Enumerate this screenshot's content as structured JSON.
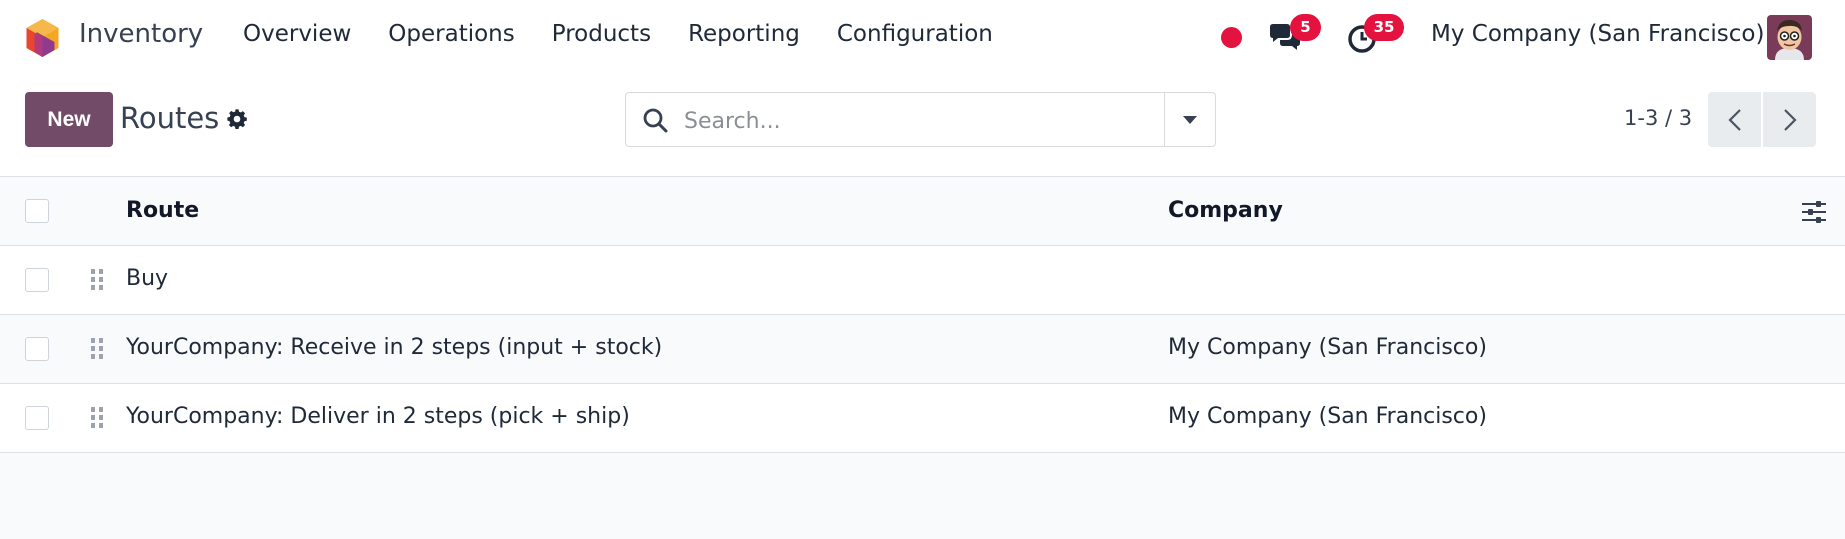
{
  "navbar": {
    "app_name": "Inventory",
    "menu": [
      "Overview",
      "Operations",
      "Products",
      "Reporting",
      "Configuration"
    ],
    "messages_count": "5",
    "activities_count": "35",
    "company": "My Company (San Francisco)",
    "status_color": "#e3123f"
  },
  "control": {
    "new_label": "New",
    "title": "Routes",
    "search_placeholder": "Search...",
    "pager_value": "1-3 / 3"
  },
  "table": {
    "columns": [
      "Route",
      "Company"
    ],
    "rows": [
      {
        "route": "Buy",
        "company": ""
      },
      {
        "route": "YourCompany: Receive in 2 steps (input + stock)",
        "company": "My Company (San Francisco)"
      },
      {
        "route": "YourCompany: Deliver in 2 steps (pick + ship)",
        "company": "My Company (San Francisco)"
      }
    ]
  },
  "colors": {
    "primary": "#714b67",
    "badge": "#e3123f"
  },
  "icons": [
    "app-logo-icon",
    "chat-icon",
    "clock-icon",
    "gear-icon",
    "search-icon",
    "caret-down-icon",
    "chevron-left-icon",
    "chevron-right-icon",
    "column-settings-icon",
    "drag-handle-icon"
  ]
}
